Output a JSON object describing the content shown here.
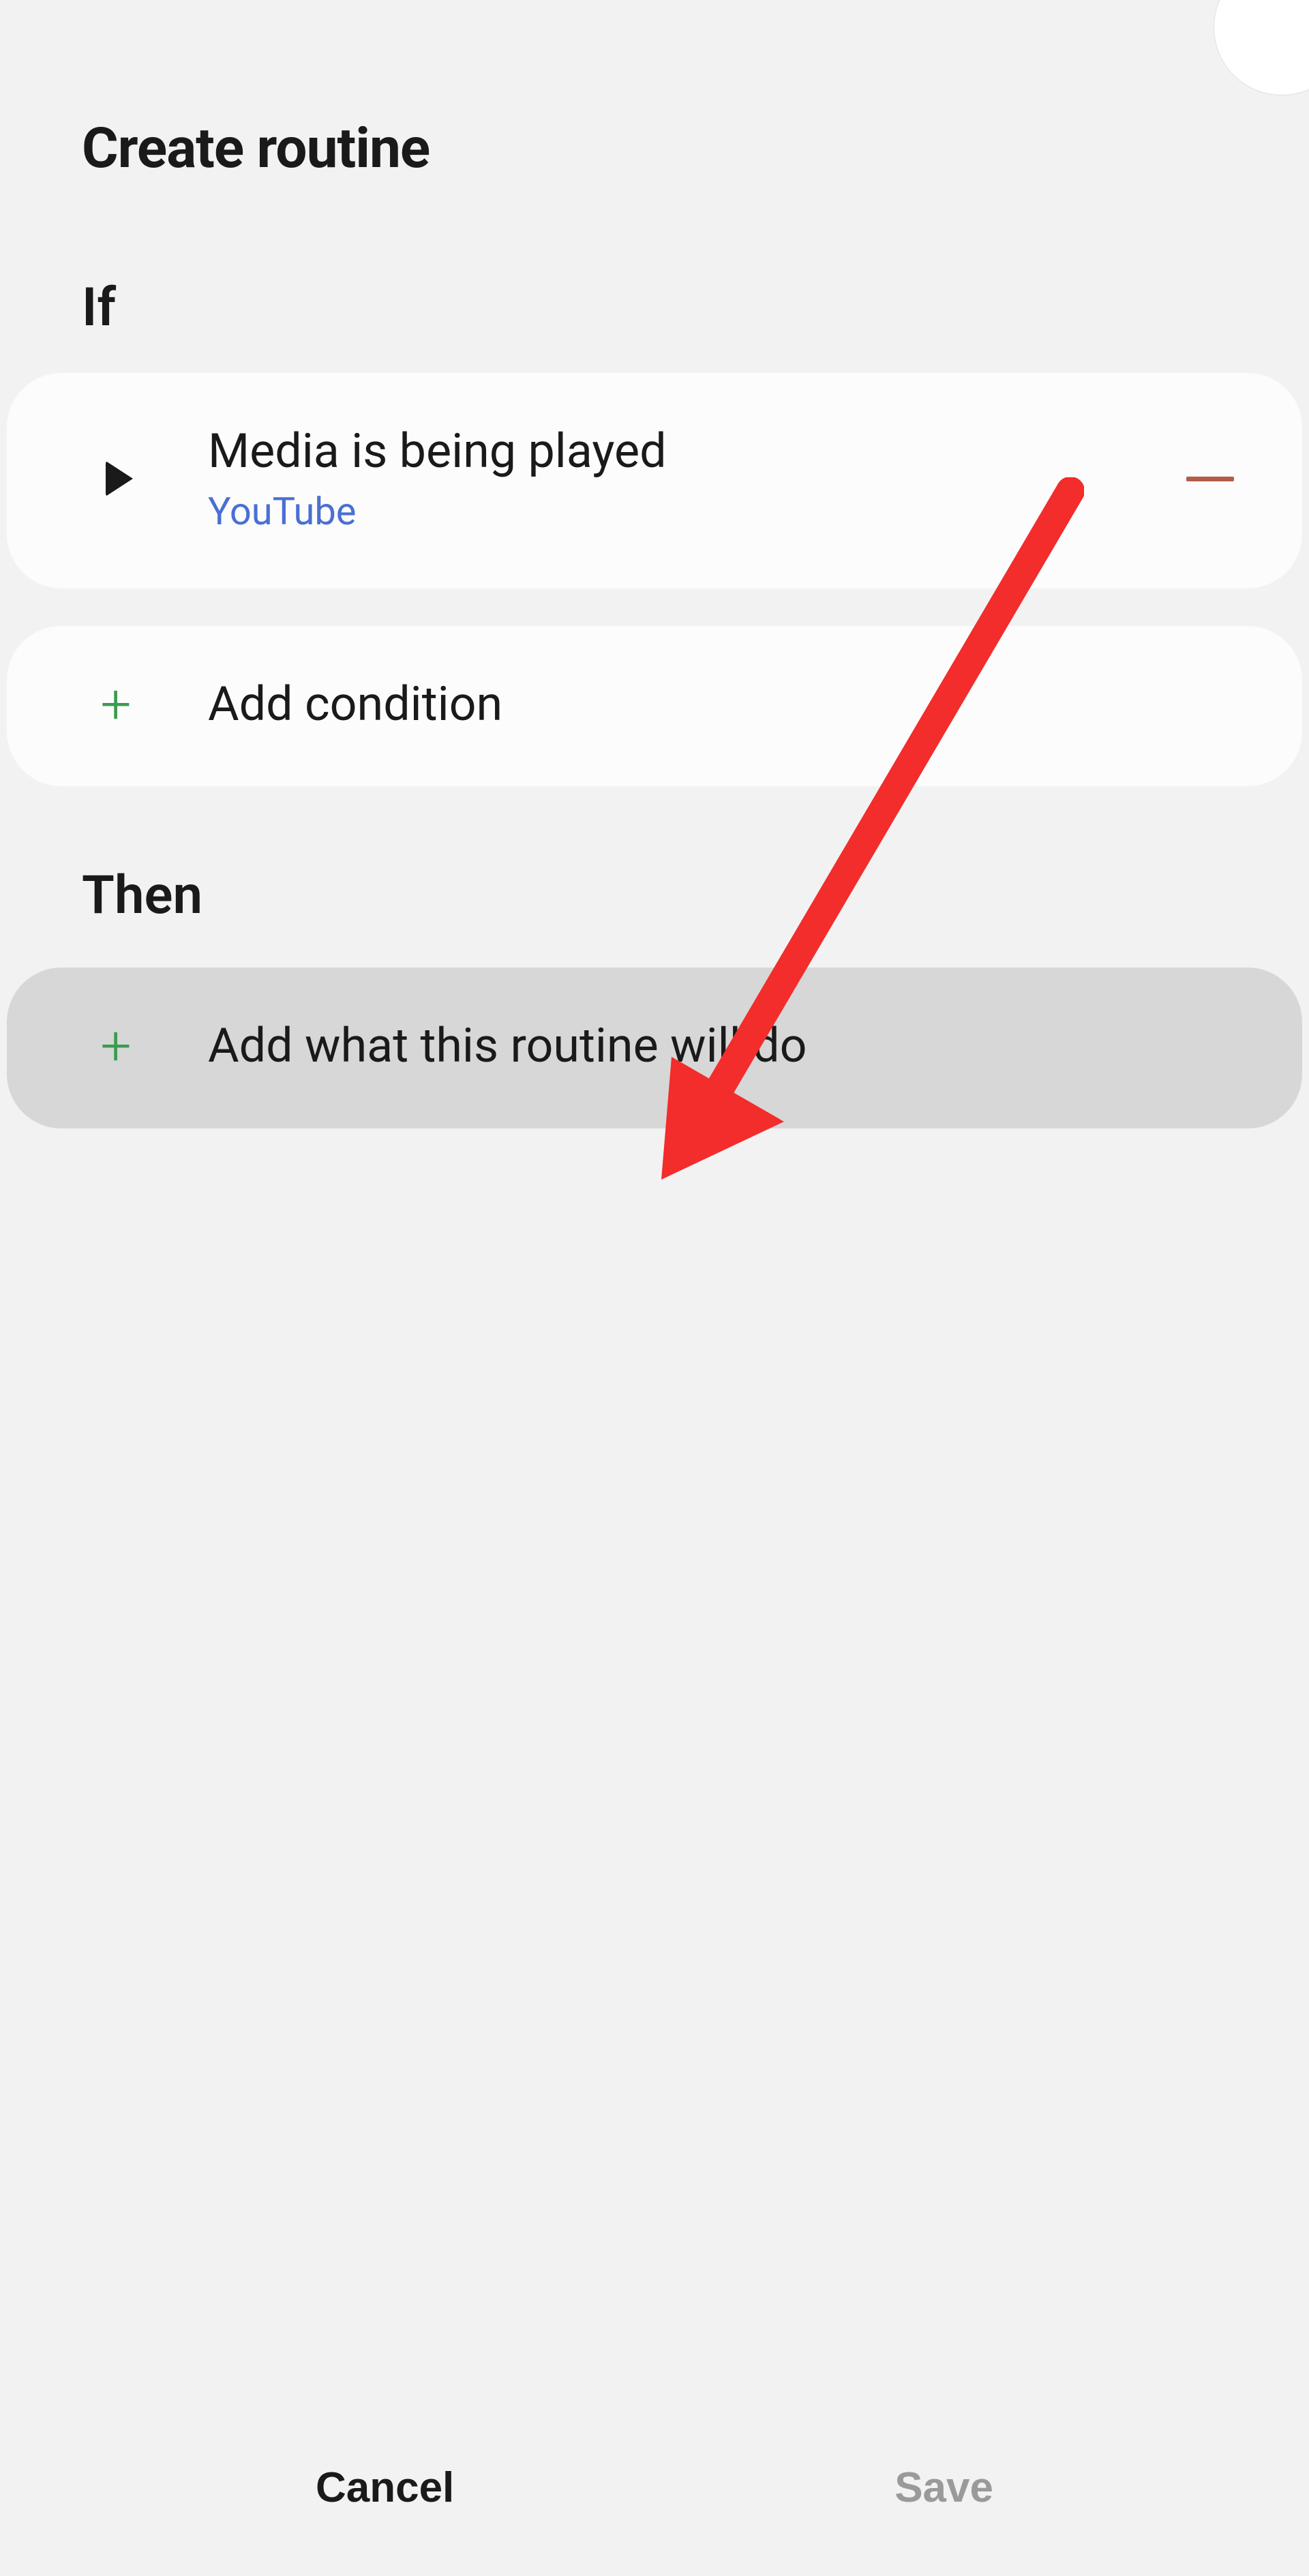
{
  "header": {
    "title": "Create routine"
  },
  "sections": {
    "if_label": "If",
    "then_label": "Then"
  },
  "condition": {
    "title": "Media is being played",
    "subtitle": "YouTube"
  },
  "add_condition": {
    "label": "Add condition"
  },
  "add_action": {
    "label": "Add what this routine will do"
  },
  "footer": {
    "cancel": "Cancel",
    "save": "Save"
  },
  "colors": {
    "accent_plus": "#3c9b4f",
    "accent_link": "#4a6fd4",
    "accent_remove": "#b25d4a",
    "annotation_arrow": "#f32c2c"
  }
}
